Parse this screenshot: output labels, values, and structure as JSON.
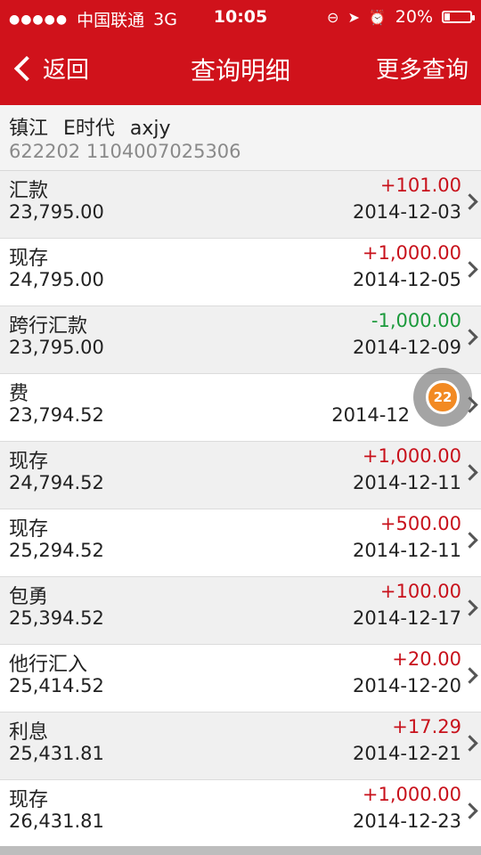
{
  "status": {
    "carrier": "中国联通",
    "network": "3G",
    "time": "10:05",
    "battery": "20%",
    "battery_level": 0.2
  },
  "nav": {
    "back_label": "返回",
    "title": "查询明细",
    "more_label": "更多查询"
  },
  "account": {
    "name_line": "镇江 E时代 axjy",
    "number": "622202 1104007025306"
  },
  "transactions": [
    {
      "type": "汇款",
      "balance": "23,795.00",
      "amount": "+101.00",
      "date": "2014-12-03"
    },
    {
      "type": "现存",
      "balance": "24,795.00",
      "amount": "+1,000.00",
      "date": "2014-12-05"
    },
    {
      "type": "跨行汇款",
      "balance": "23,795.00",
      "amount": "-1,000.00",
      "date": "2014-12-09"
    },
    {
      "type": "费",
      "balance": "23,794.52",
      "amount": "",
      "date": "2014-12"
    },
    {
      "type": "现存",
      "balance": "24,794.52",
      "amount": "+1,000.00",
      "date": "2014-12-11"
    },
    {
      "type": "现存",
      "balance": "25,294.52",
      "amount": "+500.00",
      "date": "2014-12-11"
    },
    {
      "type": "包勇",
      "balance": "25,394.52",
      "amount": "+100.00",
      "date": "2014-12-17"
    },
    {
      "type": "他行汇入",
      "balance": "25,414.52",
      "amount": "+20.00",
      "date": "2014-12-20"
    },
    {
      "type": "利息",
      "balance": "25,431.81",
      "amount": "+17.29",
      "date": "2014-12-21"
    },
    {
      "type": "现存",
      "balance": "26,431.81",
      "amount": "+1,000.00",
      "date": "2014-12-23"
    }
  ],
  "floating_badge": {
    "count": "22"
  },
  "colors": {
    "brand": "#d0121b",
    "credit": "#c8111b",
    "debit": "#1c9a3c"
  }
}
